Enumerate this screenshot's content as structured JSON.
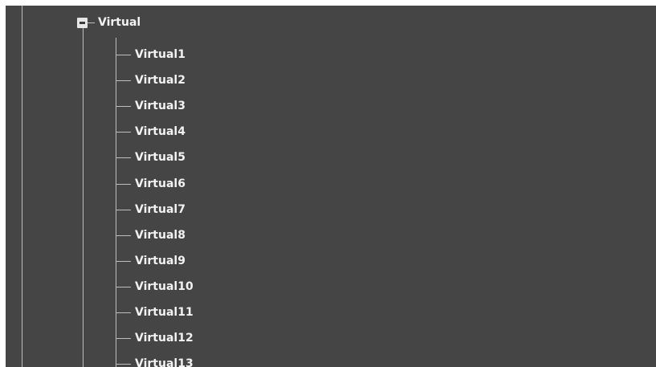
{
  "tree": {
    "parent": {
      "label": "Virtual",
      "expanded": true
    },
    "children": [
      {
        "label": "Virtual1"
      },
      {
        "label": "Virtual2"
      },
      {
        "label": "Virtual3"
      },
      {
        "label": "Virtual4"
      },
      {
        "label": "Virtual5"
      },
      {
        "label": "Virtual6"
      },
      {
        "label": "Virtual7"
      },
      {
        "label": "Virtual8"
      },
      {
        "label": "Virtual9"
      },
      {
        "label": "Virtual10"
      },
      {
        "label": "Virtual11"
      },
      {
        "label": "Virtual12"
      },
      {
        "label": "Virtual13"
      }
    ]
  },
  "colors": {
    "background": "#454545",
    "lines": "#bdbdbd",
    "text": "#f2f2f2"
  }
}
